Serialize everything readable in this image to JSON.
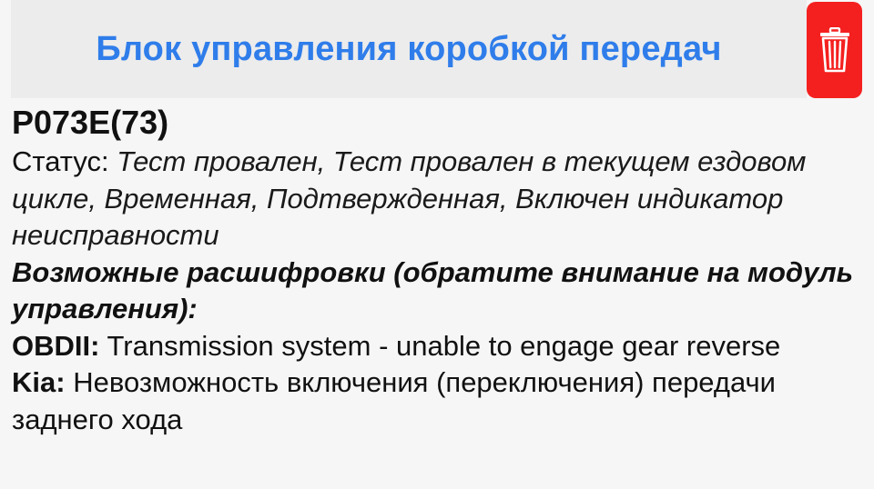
{
  "header": {
    "title": "Блок управления коробкой передач"
  },
  "icons": {
    "delete": "trash-icon"
  },
  "colors": {
    "title": "#2f7dea",
    "delete_button": "#f4201f"
  },
  "dtc": {
    "code": "P073E(73)",
    "status_label": "Статус:",
    "status_value": "Тест провален, Тест провален в текущем ездовом цикле, Временная, Подтвержденная, Включен индикатор неисправности",
    "decodings_heading": "Возможные расшифровки (обратите внимание на модуль управления):",
    "decodings": [
      {
        "source": "OBDII:",
        "text": "Transmission system - unable to engage gear reverse"
      },
      {
        "source": "Kia:",
        "text": "Невозможность включения (переключения) передачи заднего хода"
      }
    ]
  }
}
